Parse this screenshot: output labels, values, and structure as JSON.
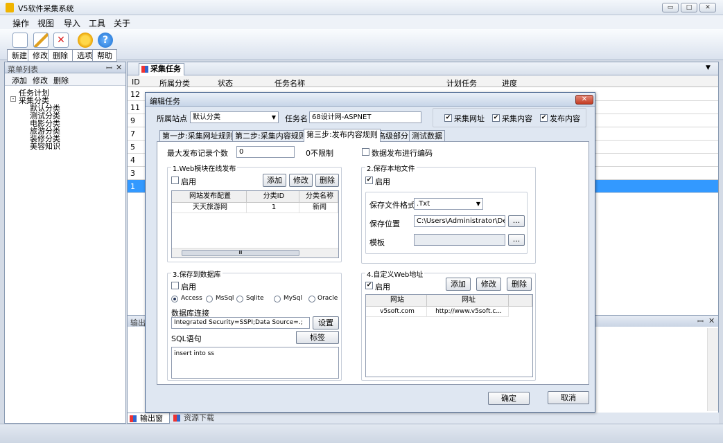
{
  "app": {
    "title": "V5软件采集系统",
    "win_min": "▭",
    "win_max": "□",
    "win_close": "✕"
  },
  "menu": [
    "操作",
    "视图",
    "导入",
    "工具",
    "关于"
  ],
  "toolbar": {
    "new": "新建",
    "edit": "修改",
    "delete": "删除",
    "options": "选项",
    "help": "帮助"
  },
  "left_panel": {
    "title": "菜单列表",
    "pin": "ꟷ",
    "close": "✕",
    "add": "添加",
    "edit": "修改",
    "delete": "删除",
    "tree": [
      "任务计划",
      "采集分类",
      "默认分类",
      "测试分类",
      "电影分类",
      "旅游分类",
      "装修分类",
      "美容知识"
    ]
  },
  "doc_tab": {
    "label": "采集任务",
    "dropdown": "▼"
  },
  "grid": {
    "headers": [
      "ID",
      "所属分类",
      "状态",
      "任务名称",
      "计划任务",
      "进度"
    ],
    "ids": [
      "12",
      "11",
      "9",
      "7",
      "5",
      "4",
      "3",
      "1"
    ]
  },
  "output": {
    "title": "输出",
    "pin": "ꟷ",
    "close": "✕",
    "tab_output": "输出窗口",
    "tab_resource": "资源下载"
  },
  "dialog": {
    "title": "编辑任务",
    "close": "✕",
    "site_label": "所属站点",
    "site_value": "默认分类",
    "task_label": "任务名",
    "task_value": "68设计网-ASPNET",
    "chk_collect_url": "采集网址",
    "chk_collect_content": "采集内容",
    "chk_publish_content": "发布内容",
    "tabs": [
      "第一步:采集网址规则",
      "第二步:采集内容规则",
      "第三步:发布内容规则",
      "高级部分",
      "测试数据"
    ],
    "max_label": "最大发布记录个数",
    "max_value": "0",
    "unlimited": "0不限制",
    "encode_label": "数据发布进行编码",
    "g1": {
      "title": "1.Web模块在线发布",
      "enable": "启用",
      "add": "添加",
      "edit": "修改",
      "delete": "删除",
      "cols": [
        "网站发布配置",
        "分类ID",
        "分类名称"
      ],
      "row": [
        "天天旅游网",
        "1",
        "新闻"
      ],
      "scroll": "Ⅲ"
    },
    "g2": {
      "title": "2.保存本地文件",
      "enable": "启用",
      "format_label": "保存文件格式",
      "format_value": ".Txt",
      "path_label": "保存位置",
      "path_value": "C:\\Users\\Administrator\\Des",
      "browse": "...",
      "template_label": "模板",
      "browse2": "..."
    },
    "g3": {
      "title": "3.保存到数据库",
      "enable": "启用",
      "db": [
        "Access",
        "MsSql",
        "Sqlite",
        "MySql",
        "Oracle"
      ],
      "conn_label": "数据库连接",
      "conn_value": "Integrated Security=SSPI;Data Source=.;",
      "set": "设置",
      "sql_label": "SQL语句",
      "tag": "标签",
      "sql_value": "insert into ss"
    },
    "g4": {
      "title": "4.自定义Web地址",
      "enable": "启用",
      "add": "添加",
      "edit": "修改",
      "delete": "删除",
      "cols": [
        "网站",
        "网址"
      ],
      "row": [
        "v5soft.com",
        "http://www.v5soft.c..."
      ]
    },
    "ok": "确定",
    "cancel": "取消"
  }
}
